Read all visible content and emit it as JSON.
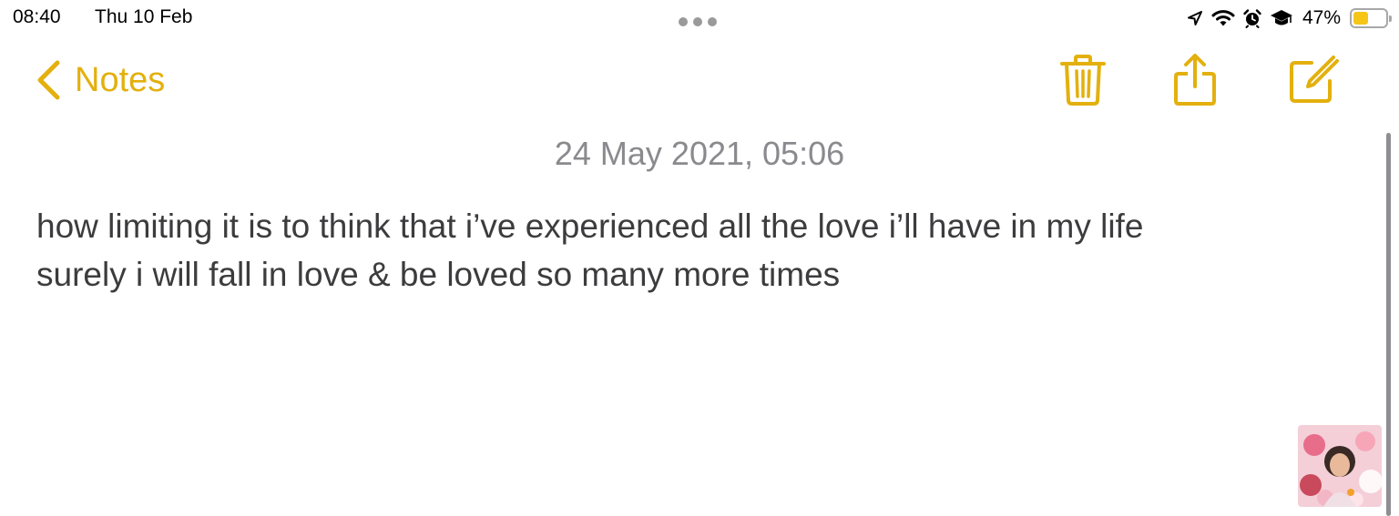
{
  "status_bar": {
    "time": "08:40",
    "date": "Thu 10 Feb",
    "battery_percent_label": "47%",
    "battery_level": 0.47,
    "icons": [
      "location-arrow-icon",
      "wifi-icon",
      "alarm-icon",
      "graduation-cap-icon",
      "battery-icon"
    ]
  },
  "nav": {
    "back_label": "Notes",
    "back_icon": "chevron-left-icon",
    "actions": [
      "trash-icon",
      "share-icon",
      "compose-icon"
    ]
  },
  "note": {
    "date": "24 May 2021, 05:06",
    "lines": [
      "how limiting it is to think that i’ve experienced all the love i’ll have in my life",
      "surely i will fall in love & be loved so many more times"
    ]
  },
  "colors": {
    "accent": "#e3b00e",
    "date_text": "#8a8a8e",
    "body_text": "#3c3c3e",
    "battery_fill": "#f5c518"
  }
}
